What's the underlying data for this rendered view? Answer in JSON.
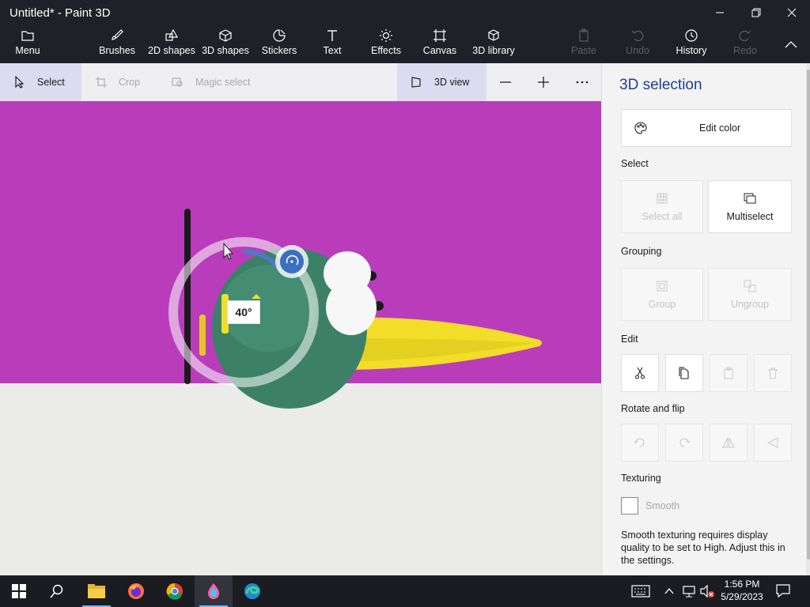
{
  "window": {
    "title": "Untitled* - Paint 3D"
  },
  "ribbon": {
    "menu": "Menu",
    "tools": [
      "Brushes",
      "2D shapes",
      "3D shapes",
      "Stickers",
      "Text",
      "Effects",
      "Canvas",
      "3D library"
    ],
    "paste": "Paste",
    "undo": "Undo",
    "history": "History",
    "redo": "Redo"
  },
  "toolbar": {
    "select": "Select",
    "crop": "Crop",
    "magic_select": "Magic select",
    "view_3d": "3D view",
    "rotation_readout": "40°"
  },
  "panel": {
    "title": "3D selection",
    "edit_color": "Edit color",
    "select_heading": "Select",
    "select_all": "Select all",
    "multiselect": "Multiselect",
    "grouping_heading": "Grouping",
    "group": "Group",
    "ungroup": "Ungroup",
    "edit_heading": "Edit",
    "rotate_heading": "Rotate and flip",
    "texturing_heading": "Texturing",
    "smooth": "Smooth",
    "smooth_note": "Smooth texturing requires display quality to be set to High. Adjust this in the settings."
  },
  "taskbar": {
    "time": "1:56 PM",
    "date": "5/29/2023",
    "apps": [
      "windows-start",
      "search",
      "file-explorer",
      "firefox",
      "chrome",
      "paint-3d",
      "edge"
    ]
  },
  "colors": {
    "canvas": "#b93dbb",
    "accent": "#1f3f8f",
    "sphere": "#3d8068",
    "yellow": "#f2de28"
  }
}
